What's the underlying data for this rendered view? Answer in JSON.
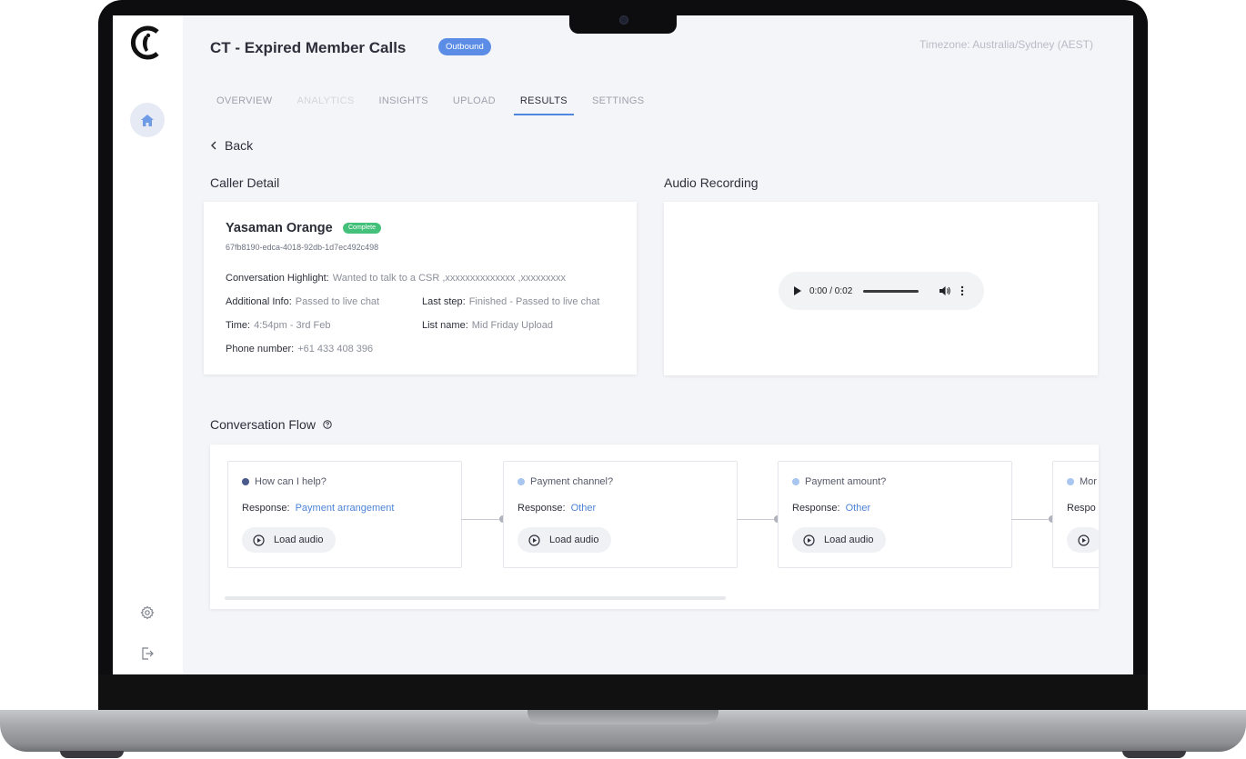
{
  "header": {
    "title": "CT - Expired Member Calls",
    "badge": "Outbound",
    "timezone": "Timezone: Australia/Sydney (AEST)"
  },
  "tabs": [
    {
      "label": "OVERVIEW",
      "state": "normal"
    },
    {
      "label": "ANALYTICS",
      "state": "disabled"
    },
    {
      "label": "INSIGHTS",
      "state": "normal"
    },
    {
      "label": "UPLOAD",
      "state": "normal"
    },
    {
      "label": "RESULTS",
      "state": "active"
    },
    {
      "label": "SETTINGS",
      "state": "normal"
    }
  ],
  "nav": {
    "back_label": "Back"
  },
  "caller": {
    "section_title": "Caller Detail",
    "name": "Yasaman Orange",
    "status": "Complete",
    "id": "67fb8190-edca-4018-92db-1d7ec492c498",
    "highlight_label": "Conversation Highlight:",
    "highlight_value": "Wanted to talk to a CSR ,xxxxxxxxxxxxxx ,xxxxxxxxx",
    "additional_label": "Additional Info:",
    "additional_value": "Passed to live chat",
    "last_step_label": "Last step:",
    "last_step_value": "Finished - Passed to live chat",
    "time_label": "Time:",
    "time_value": "4:54pm - 3rd Feb",
    "list_label": "List name:",
    "list_value": "Mid Friday Upload",
    "phone_label": "Phone number:",
    "phone_value": "+61 433 408 396"
  },
  "audio": {
    "section_title": "Audio Recording",
    "time": "0:00 / 0:02"
  },
  "flow": {
    "section_title": "Conversation Flow",
    "response_label": "Response:",
    "load_label": "Load audio",
    "nodes": [
      {
        "question": "How can I help?",
        "response": "Payment arrangement"
      },
      {
        "question": "Payment channel?",
        "response": "Other"
      },
      {
        "question": "Payment amount?",
        "response": "Other"
      },
      {
        "question": "Mor",
        "response": ""
      }
    ],
    "partial_resp_label": "Respo"
  },
  "colors": {
    "accent": "#4f86e0",
    "badge_outbound": "#5b8de6",
    "badge_complete": "#43c07a",
    "link": "#4c84d8"
  }
}
